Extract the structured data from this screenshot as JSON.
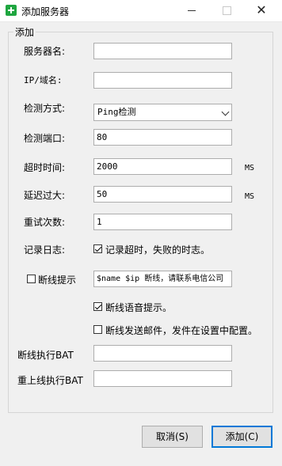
{
  "window": {
    "title": "添加服务器",
    "minimize_glyph": "—",
    "close_glyph": "✕"
  },
  "group": {
    "legend": "添加"
  },
  "form": {
    "server_name": {
      "label": "服务器名:",
      "value": ""
    },
    "ip_domain": {
      "label": "IP/域名:",
      "value": ""
    },
    "detect_method": {
      "label": "检测方式:",
      "value": "Ping检测"
    },
    "detect_port": {
      "label": "检测端口:",
      "value": "80"
    },
    "timeout": {
      "label": "超时时间:",
      "value": "2000",
      "unit": "MS"
    },
    "delay": {
      "label": "延迟过大:",
      "value": "50",
      "unit": "MS"
    },
    "retries": {
      "label": "重试次数:",
      "value": "1"
    },
    "log": {
      "label": "记录日志:",
      "checkbox_label": "记录超时，失败的时志。",
      "checked": true
    },
    "disconnect_notice": {
      "checkbox_label": "断线提示",
      "checked": false,
      "value": "$name $ip 断线，请联系电信公司"
    },
    "voice_notice": {
      "checkbox_label": "断线语音提示。",
      "checked": true
    },
    "email_notice": {
      "checkbox_label": "断线发送邮件，发件在设置中配置。",
      "checked": false
    },
    "disconnect_bat": {
      "label": "断线执行BAT",
      "value": ""
    },
    "reconnect_bat": {
      "label": "重上线执行BAT",
      "value": ""
    }
  },
  "buttons": {
    "cancel": "取消(S)",
    "add": "添加(C)"
  }
}
